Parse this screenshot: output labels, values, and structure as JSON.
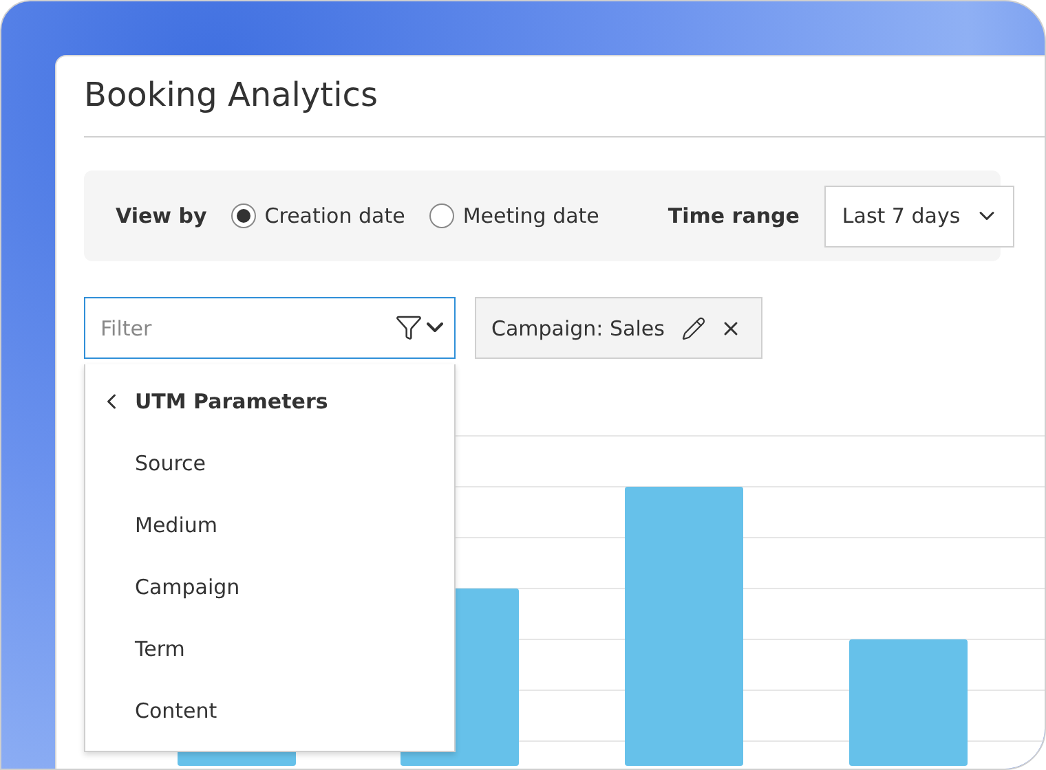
{
  "title": "Booking Analytics",
  "toolbar": {
    "view_by_label": "View by",
    "view_options": [
      {
        "label": "Creation date",
        "selected": true
      },
      {
        "label": "Meeting date",
        "selected": false
      }
    ],
    "time_range_label": "Time range",
    "time_range_value": "Last 7 days"
  },
  "filter": {
    "placeholder": "Filter",
    "expanded": true
  },
  "chips": [
    {
      "label": "Campaign: Sales"
    }
  ],
  "dropdown": {
    "header": "UTM Parameters",
    "items": [
      "Source",
      "Medium",
      "Campaign",
      "Term",
      "Content"
    ]
  }
}
